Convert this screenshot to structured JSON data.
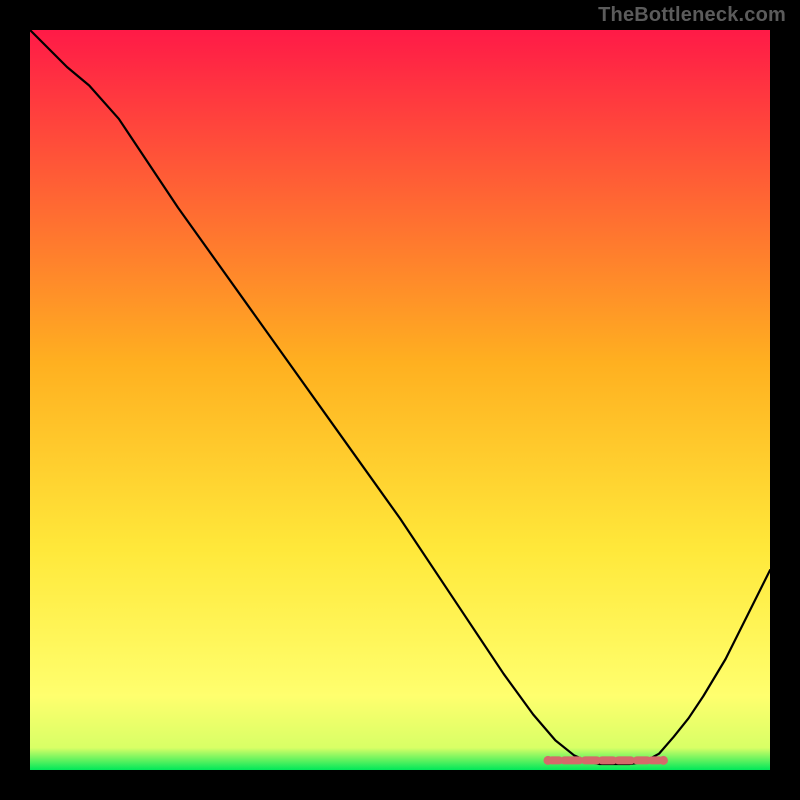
{
  "watermark": "TheBottleneck.com",
  "chart_data": {
    "type": "line",
    "title": "",
    "xlabel": "",
    "ylabel": "",
    "xlim": [
      0,
      100
    ],
    "ylim": [
      0,
      100
    ],
    "grid": false,
    "legend": false,
    "background_gradient": {
      "top_color": "#ff1a47",
      "mid_color": "#ffd820",
      "lower_color": "#ffff6e",
      "bottom_color": "#00e85a"
    },
    "curve": {
      "stroke": "#000000",
      "points": [
        [
          0,
          100
        ],
        [
          5,
          95
        ],
        [
          8,
          92.5
        ],
        [
          12,
          88
        ],
        [
          20,
          76
        ],
        [
          30,
          62
        ],
        [
          40,
          48
        ],
        [
          50,
          34
        ],
        [
          58,
          22
        ],
        [
          64,
          13
        ],
        [
          68,
          7.5
        ],
        [
          71,
          4
        ],
        [
          73.5,
          2
        ],
        [
          75.5,
          1.1
        ],
        [
          77,
          0.8
        ],
        [
          79,
          0.8
        ],
        [
          81,
          0.8
        ],
        [
          83,
          1.1
        ],
        [
          85,
          2.2
        ],
        [
          87,
          4.5
        ],
        [
          89,
          7
        ],
        [
          91,
          10
        ],
        [
          94,
          15
        ],
        [
          97,
          21
        ],
        [
          100,
          27
        ]
      ]
    },
    "marker_band": {
      "color": "#d46a6a",
      "y": 1.3,
      "x_segments": [
        [
          70.5,
          71.5
        ],
        [
          72.2,
          74.2
        ],
        [
          75.0,
          76.6
        ],
        [
          77.3,
          78.8
        ],
        [
          79.5,
          81.2
        ],
        [
          82.0,
          83.4
        ],
        [
          84.0,
          85.0
        ]
      ],
      "x_dots": [
        70.0,
        85.6
      ]
    }
  }
}
